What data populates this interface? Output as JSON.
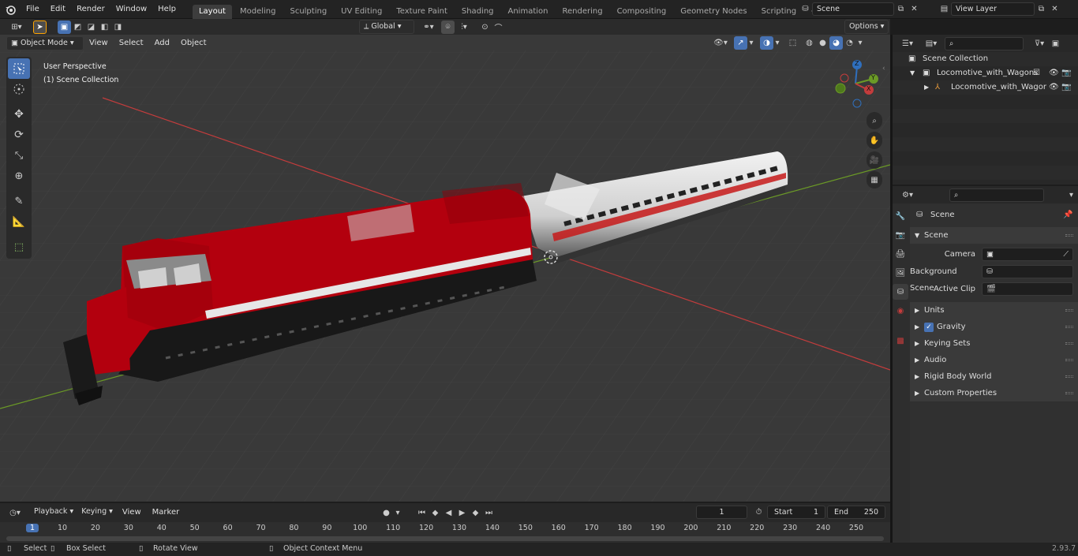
{
  "menu": [
    "File",
    "Edit",
    "Render",
    "Window",
    "Help"
  ],
  "workspaces": [
    "Layout",
    "Modeling",
    "Sculpting",
    "UV Editing",
    "Texture Paint",
    "Shading",
    "Animation",
    "Rendering",
    "Compositing",
    "Geometry Nodes",
    "Scripting"
  ],
  "scene_field": "Scene",
  "view_layer_field": "View Layer",
  "transform_orientation": "Global",
  "options_label": "Options",
  "viewport_menu": {
    "mode": "Object Mode",
    "items": [
      "View",
      "Select",
      "Add",
      "Object"
    ]
  },
  "viewport_info": {
    "line1": "User Perspective",
    "line2": "(1) Scene Collection"
  },
  "gizmo": {
    "x": "X",
    "y": "Y",
    "z": "Z"
  },
  "outliner": {
    "root": "Scene Collection",
    "collection": "Locomotive_with_Wagons",
    "object": "Locomotive_with_Wagor"
  },
  "properties": {
    "header": "Scene",
    "panel": "Scene",
    "camera_label": "Camera",
    "background_label": "Background Scene",
    "clip_label": "Active Clip",
    "sections": [
      "Units",
      "Gravity",
      "Keying Sets",
      "Audio",
      "Rigid Body World",
      "Custom Properties"
    ]
  },
  "timeline": {
    "menus": [
      "Playback",
      "Keying",
      "View",
      "Marker"
    ],
    "current_frame": "1",
    "start_label": "Start",
    "start": "1",
    "end_label": "End",
    "end": "250",
    "ruler": [
      "1",
      "10",
      "20",
      "30",
      "40",
      "50",
      "60",
      "70",
      "80",
      "90",
      "100",
      "110",
      "120",
      "130",
      "140",
      "150",
      "160",
      "170",
      "180",
      "190",
      "200",
      "210",
      "220",
      "230",
      "240",
      "250"
    ]
  },
  "status": {
    "select": "Select",
    "box_select": "Box Select",
    "rotate": "Rotate View",
    "context": "Object Context Menu",
    "version": "2.93.7"
  },
  "colors": {
    "accent": "#4772b3",
    "locomotive": "#b3000e",
    "axis_x": "#c43c3c",
    "axis_y": "#6b9a26"
  }
}
